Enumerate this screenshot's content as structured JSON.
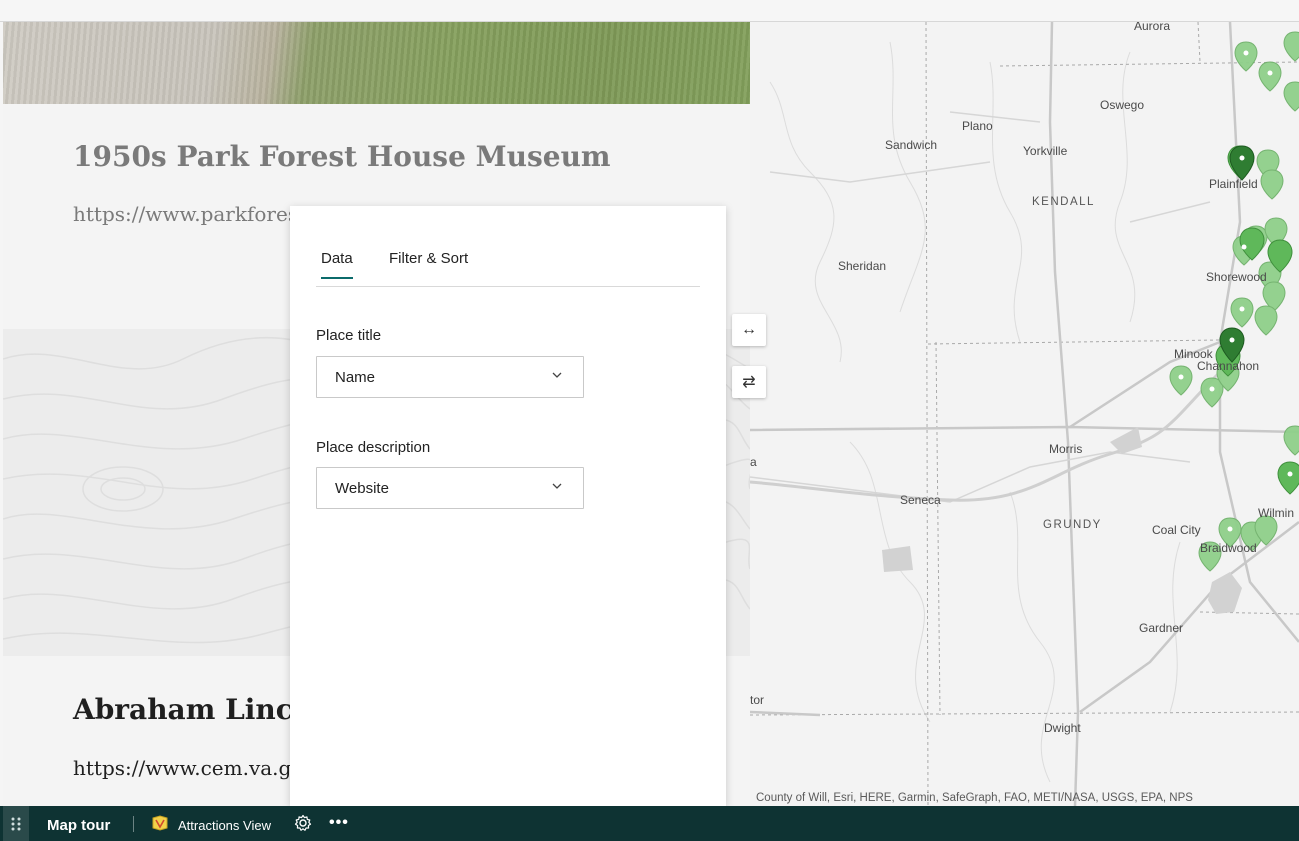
{
  "story": {
    "item1_title": "1950s Park Forest House Museum",
    "item1_link": "https://www.parkfores",
    "item2_title": "Abraham Linco",
    "item2_link": "https://www.cem.va.gc"
  },
  "panel": {
    "tabs": [
      {
        "label": "Data",
        "active": true
      },
      {
        "label": "Filter & Sort",
        "active": false
      }
    ],
    "place_title_label": "Place title",
    "place_title_value": "Name",
    "place_description_label": "Place description",
    "place_description_value": "Website"
  },
  "map": {
    "labels": {
      "aurora": "Aurora",
      "oswego": "Oswego",
      "plano": "Plano",
      "sandwich": "Sandwich",
      "yorkville": "Yorkville",
      "plainfield": "Plainfield",
      "kendall": "KENDALL",
      "sheridan": "Sheridan",
      "shorewood": "Shorewood",
      "minooka": "Minook",
      "channahon": "Channahon",
      "morris": "Morris",
      "seneca": "Seneca",
      "grundy": "GRUNDY",
      "coal_city": "Coal City",
      "wilmington": "Wilmin",
      "braidwood": "Braidwood",
      "gardner": "Gardner",
      "dwight": "Dwight",
      "edge_a": "a",
      "edge_tor": "tor"
    },
    "attribution": "County of Will, Esri, HERE, Garmin, SafeGraph, FAO, METI/NASA, USGS, EPA, NPS",
    "marker_color": "#5fb85a",
    "marker_selected_color": "#2f7d32"
  },
  "controls": {
    "expand_icon": "↔",
    "swap_icon": "⇄"
  },
  "bottombar": {
    "title": "Map tour",
    "layer_name": "Attractions View",
    "more": "•••"
  }
}
